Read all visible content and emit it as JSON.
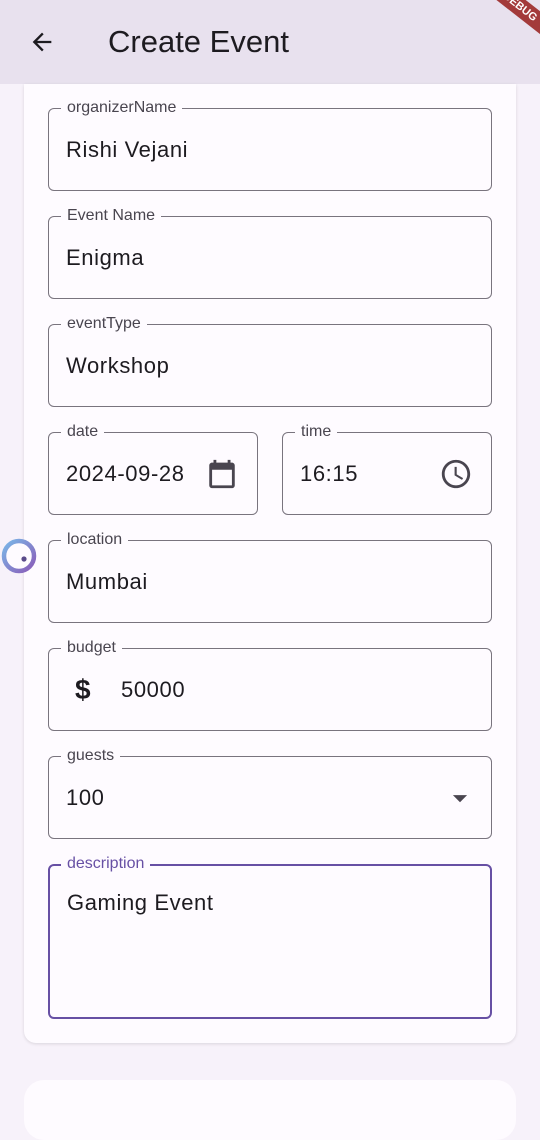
{
  "appbar": {
    "title": "Create Event",
    "debug_banner": "DEBUG"
  },
  "form": {
    "organizer": {
      "label": "organizerName",
      "value": "Rishi Vejani"
    },
    "event_name": {
      "label": "Event Name",
      "value": "Enigma"
    },
    "event_type": {
      "label": "eventType",
      "value": "Workshop"
    },
    "date": {
      "label": "date",
      "value": "2024-09-28"
    },
    "time": {
      "label": "time",
      "value": "16:15"
    },
    "location": {
      "label": "location",
      "value": "Mumbai"
    },
    "budget": {
      "label": "budget",
      "prefix": "$",
      "value": "50000"
    },
    "guests": {
      "label": "guests",
      "value": "100"
    },
    "description": {
      "label": "description",
      "value": "Gaming Event"
    }
  },
  "colors": {
    "appbar_bg": "#e8e1ee",
    "focus": "#6750a4",
    "outline": "#79747e"
  },
  "icons": [
    "arrow-back-icon",
    "calendar-icon",
    "clock-icon",
    "dropdown-arrow-icon",
    "loading-spinner-icon"
  ]
}
